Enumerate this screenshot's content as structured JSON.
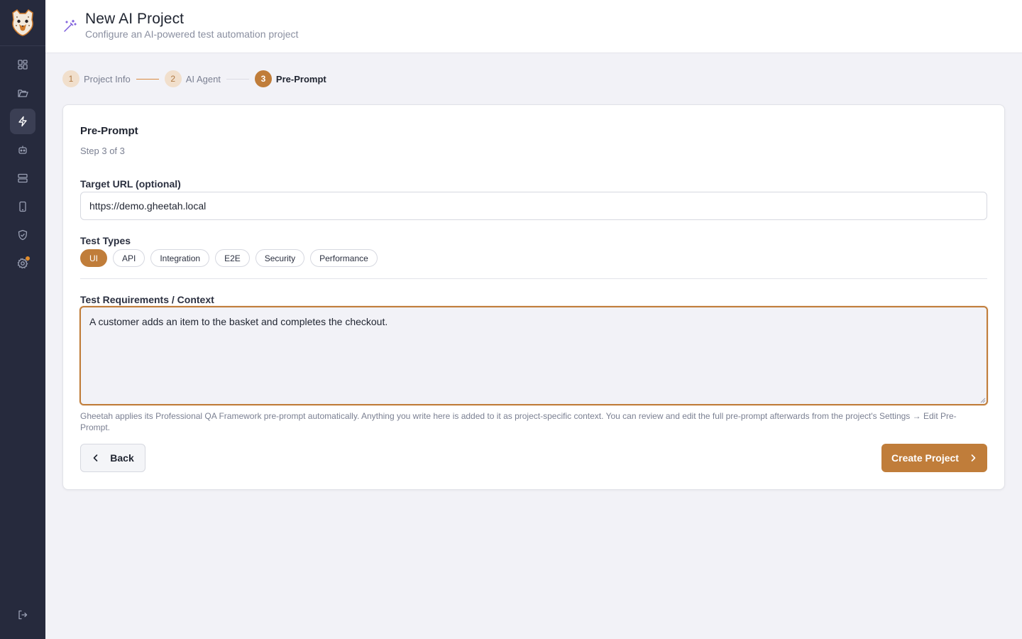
{
  "header": {
    "title": "New AI Project",
    "subtitle": "Configure an AI-powered test automation project"
  },
  "sidebar": {
    "items": [
      {
        "icon": "dashboard-icon",
        "active": false
      },
      {
        "icon": "folder-icon",
        "active": false
      },
      {
        "icon": "lightning-icon",
        "active": true
      },
      {
        "icon": "bot-icon",
        "active": false
      },
      {
        "icon": "server-icon",
        "active": false
      },
      {
        "icon": "mobile-icon",
        "active": false
      },
      {
        "icon": "shield-check-icon",
        "active": false
      },
      {
        "icon": "gear-icon",
        "active": false,
        "notification": true
      }
    ],
    "footer_icon": "logout-icon"
  },
  "stepper": {
    "steps": [
      {
        "number": "1",
        "label": "Project Info",
        "state": "done"
      },
      {
        "number": "2",
        "label": "AI Agent",
        "state": "done"
      },
      {
        "number": "3",
        "label": "Pre-Prompt",
        "state": "current"
      }
    ]
  },
  "card": {
    "title": "Pre-Prompt",
    "subtitle": "Step 3 of 3",
    "target_url": {
      "label": "Target URL (optional)",
      "value": "https://demo.gheetah.local"
    },
    "test_types": {
      "label": "Test Types",
      "options": [
        "UI",
        "API",
        "Integration",
        "E2E",
        "Security",
        "Performance"
      ],
      "selected": "UI"
    },
    "requirements": {
      "label": "Test Requirements / Context",
      "value": "A customer adds an item to the basket and completes the checkout."
    },
    "help_text": "Gheetah applies its Professional QA Framework pre-prompt automatically. Anything you write here is added to it as project-specific context. You can review and edit the full pre-prompt afterwards from the project's Settings → Edit Pre-Prompt.",
    "back_label": "Back",
    "create_label": "Create Project"
  },
  "colors": {
    "accent": "#c07d3a",
    "sidebar_bg": "#262a3d",
    "step_done_bg": "#f1dfcc",
    "wand": "#7c5cdb"
  }
}
